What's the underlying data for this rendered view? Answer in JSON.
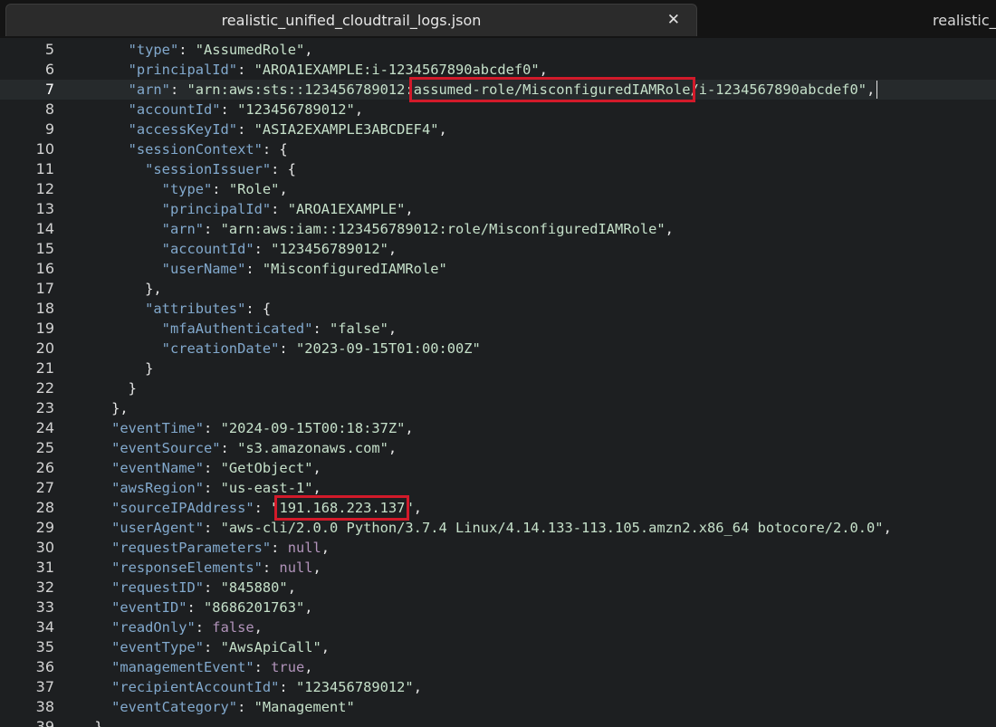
{
  "tabs": [
    {
      "label": "realistic_unified_cloudtrail_logs.json",
      "active": true,
      "close_label": "✕"
    },
    {
      "label": "realistic_",
      "active": false
    }
  ],
  "editor": {
    "current_line": 7,
    "highlights": [
      "assumed-role/MisconfiguredIAMRole",
      "191.168.223.137"
    ],
    "lines": [
      {
        "n": 5,
        "tokens": [
          {
            "t": "      "
          },
          {
            "t": "\"type\"",
            "c": "k"
          },
          {
            "t": ": "
          },
          {
            "t": "\"AssumedRole\"",
            "c": "s"
          },
          {
            "t": ","
          }
        ]
      },
      {
        "n": 6,
        "tokens": [
          {
            "t": "      "
          },
          {
            "t": "\"principalId\"",
            "c": "k"
          },
          {
            "t": ": "
          },
          {
            "t": "\"AROA1EXAMPLE:i-1234567890abcdef0\"",
            "c": "s"
          },
          {
            "t": ","
          }
        ]
      },
      {
        "n": 7,
        "tokens": [
          {
            "t": "      "
          },
          {
            "t": "\"arn\"",
            "c": "k"
          },
          {
            "t": ": "
          },
          {
            "t": "\"arn:aws:sts::123456789012:",
            "c": "s"
          },
          {
            "t": "assumed-role/MisconfiguredIAMRole",
            "c": "s",
            "hl": true
          },
          {
            "t": "/i-1234567890abcdef0\"",
            "c": "s"
          },
          {
            "t": ","
          }
        ]
      },
      {
        "n": 8,
        "tokens": [
          {
            "t": "      "
          },
          {
            "t": "\"accountId\"",
            "c": "k"
          },
          {
            "t": ": "
          },
          {
            "t": "\"123456789012\"",
            "c": "s"
          },
          {
            "t": ","
          }
        ]
      },
      {
        "n": 9,
        "tokens": [
          {
            "t": "      "
          },
          {
            "t": "\"accessKeyId\"",
            "c": "k"
          },
          {
            "t": ": "
          },
          {
            "t": "\"ASIA2EXAMPLE3ABCDEF4\"",
            "c": "s"
          },
          {
            "t": ","
          }
        ]
      },
      {
        "n": 10,
        "tokens": [
          {
            "t": "      "
          },
          {
            "t": "\"sessionContext\"",
            "c": "k"
          },
          {
            "t": ": {"
          }
        ]
      },
      {
        "n": 11,
        "tokens": [
          {
            "t": "        "
          },
          {
            "t": "\"sessionIssuer\"",
            "c": "k"
          },
          {
            "t": ": {"
          }
        ]
      },
      {
        "n": 12,
        "tokens": [
          {
            "t": "          "
          },
          {
            "t": "\"type\"",
            "c": "k"
          },
          {
            "t": ": "
          },
          {
            "t": "\"Role\"",
            "c": "s"
          },
          {
            "t": ","
          }
        ]
      },
      {
        "n": 13,
        "tokens": [
          {
            "t": "          "
          },
          {
            "t": "\"principalId\"",
            "c": "k"
          },
          {
            "t": ": "
          },
          {
            "t": "\"AROA1EXAMPLE\"",
            "c": "s"
          },
          {
            "t": ","
          }
        ]
      },
      {
        "n": 14,
        "tokens": [
          {
            "t": "          "
          },
          {
            "t": "\"arn\"",
            "c": "k"
          },
          {
            "t": ": "
          },
          {
            "t": "\"arn:aws:iam::123456789012:role/MisconfiguredIAMRole\"",
            "c": "s"
          },
          {
            "t": ","
          }
        ]
      },
      {
        "n": 15,
        "tokens": [
          {
            "t": "          "
          },
          {
            "t": "\"accountId\"",
            "c": "k"
          },
          {
            "t": ": "
          },
          {
            "t": "\"123456789012\"",
            "c": "s"
          },
          {
            "t": ","
          }
        ]
      },
      {
        "n": 16,
        "tokens": [
          {
            "t": "          "
          },
          {
            "t": "\"userName\"",
            "c": "k"
          },
          {
            "t": ": "
          },
          {
            "t": "\"MisconfiguredIAMRole\"",
            "c": "s"
          }
        ]
      },
      {
        "n": 17,
        "tokens": [
          {
            "t": "        },"
          }
        ]
      },
      {
        "n": 18,
        "tokens": [
          {
            "t": "        "
          },
          {
            "t": "\"attributes\"",
            "c": "k"
          },
          {
            "t": ": {"
          }
        ]
      },
      {
        "n": 19,
        "tokens": [
          {
            "t": "          "
          },
          {
            "t": "\"mfaAuthenticated\"",
            "c": "k"
          },
          {
            "t": ": "
          },
          {
            "t": "\"false\"",
            "c": "s"
          },
          {
            "t": ","
          }
        ]
      },
      {
        "n": 20,
        "tokens": [
          {
            "t": "          "
          },
          {
            "t": "\"creationDate\"",
            "c": "k"
          },
          {
            "t": ": "
          },
          {
            "t": "\"2023-09-15T01:00:00Z\"",
            "c": "s"
          }
        ]
      },
      {
        "n": 21,
        "tokens": [
          {
            "t": "        }"
          }
        ]
      },
      {
        "n": 22,
        "tokens": [
          {
            "t": "      }"
          }
        ]
      },
      {
        "n": 23,
        "tokens": [
          {
            "t": "    },"
          }
        ]
      },
      {
        "n": 24,
        "tokens": [
          {
            "t": "    "
          },
          {
            "t": "\"eventTime\"",
            "c": "k"
          },
          {
            "t": ": "
          },
          {
            "t": "\"2024-09-15T00:18:37Z\"",
            "c": "s"
          },
          {
            "t": ","
          }
        ]
      },
      {
        "n": 25,
        "tokens": [
          {
            "t": "    "
          },
          {
            "t": "\"eventSource\"",
            "c": "k"
          },
          {
            "t": ": "
          },
          {
            "t": "\"s3.amazonaws.com\"",
            "c": "s"
          },
          {
            "t": ","
          }
        ]
      },
      {
        "n": 26,
        "tokens": [
          {
            "t": "    "
          },
          {
            "t": "\"eventName\"",
            "c": "k"
          },
          {
            "t": ": "
          },
          {
            "t": "\"GetObject\"",
            "c": "s"
          },
          {
            "t": ","
          }
        ]
      },
      {
        "n": 27,
        "tokens": [
          {
            "t": "    "
          },
          {
            "t": "\"awsRegion\"",
            "c": "k"
          },
          {
            "t": ": "
          },
          {
            "t": "\"us-east-1\"",
            "c": "s"
          },
          {
            "t": ","
          }
        ]
      },
      {
        "n": 28,
        "tokens": [
          {
            "t": "    "
          },
          {
            "t": "\"sourceIPAddress\"",
            "c": "k"
          },
          {
            "t": ": "
          },
          {
            "t": "\"",
            "c": "s"
          },
          {
            "t": "191.168.223.137",
            "c": "s",
            "hl": true
          },
          {
            "t": "\"",
            "c": "s"
          },
          {
            "t": ","
          }
        ]
      },
      {
        "n": 29,
        "tokens": [
          {
            "t": "    "
          },
          {
            "t": "\"userAgent\"",
            "c": "k"
          },
          {
            "t": ": "
          },
          {
            "t": "\"aws-cli/2.0.0 Python/3.7.4 Linux/4.14.133-113.105.amzn2.x86_64 botocore/2.0.0\"",
            "c": "s"
          },
          {
            "t": ","
          }
        ]
      },
      {
        "n": 30,
        "tokens": [
          {
            "t": "    "
          },
          {
            "t": "\"requestParameters\"",
            "c": "k"
          },
          {
            "t": ": "
          },
          {
            "t": "null",
            "c": "kw"
          },
          {
            "t": ","
          }
        ]
      },
      {
        "n": 31,
        "tokens": [
          {
            "t": "    "
          },
          {
            "t": "\"responseElements\"",
            "c": "k"
          },
          {
            "t": ": "
          },
          {
            "t": "null",
            "c": "kw"
          },
          {
            "t": ","
          }
        ]
      },
      {
        "n": 32,
        "tokens": [
          {
            "t": "    "
          },
          {
            "t": "\"requestID\"",
            "c": "k"
          },
          {
            "t": ": "
          },
          {
            "t": "\"845880\"",
            "c": "s"
          },
          {
            "t": ","
          }
        ]
      },
      {
        "n": 33,
        "tokens": [
          {
            "t": "    "
          },
          {
            "t": "\"eventID\"",
            "c": "k"
          },
          {
            "t": ": "
          },
          {
            "t": "\"8686201763\"",
            "c": "s"
          },
          {
            "t": ","
          }
        ]
      },
      {
        "n": 34,
        "tokens": [
          {
            "t": "    "
          },
          {
            "t": "\"readOnly\"",
            "c": "k"
          },
          {
            "t": ": "
          },
          {
            "t": "false",
            "c": "kw"
          },
          {
            "t": ","
          }
        ]
      },
      {
        "n": 35,
        "tokens": [
          {
            "t": "    "
          },
          {
            "t": "\"eventType\"",
            "c": "k"
          },
          {
            "t": ": "
          },
          {
            "t": "\"AwsApiCall\"",
            "c": "s"
          },
          {
            "t": ","
          }
        ]
      },
      {
        "n": 36,
        "tokens": [
          {
            "t": "    "
          },
          {
            "t": "\"managementEvent\"",
            "c": "k"
          },
          {
            "t": ": "
          },
          {
            "t": "true",
            "c": "kw"
          },
          {
            "t": ","
          }
        ]
      },
      {
        "n": 37,
        "tokens": [
          {
            "t": "    "
          },
          {
            "t": "\"recipientAccountId\"",
            "c": "k"
          },
          {
            "t": ": "
          },
          {
            "t": "\"123456789012\"",
            "c": "s"
          },
          {
            "t": ","
          }
        ]
      },
      {
        "n": 38,
        "tokens": [
          {
            "t": "    "
          },
          {
            "t": "\"eventCategory\"",
            "c": "k"
          },
          {
            "t": ": "
          },
          {
            "t": "\"Management\"",
            "c": "s"
          }
        ]
      },
      {
        "n": 39,
        "tokens": [
          {
            "t": "  },"
          }
        ]
      }
    ]
  }
}
